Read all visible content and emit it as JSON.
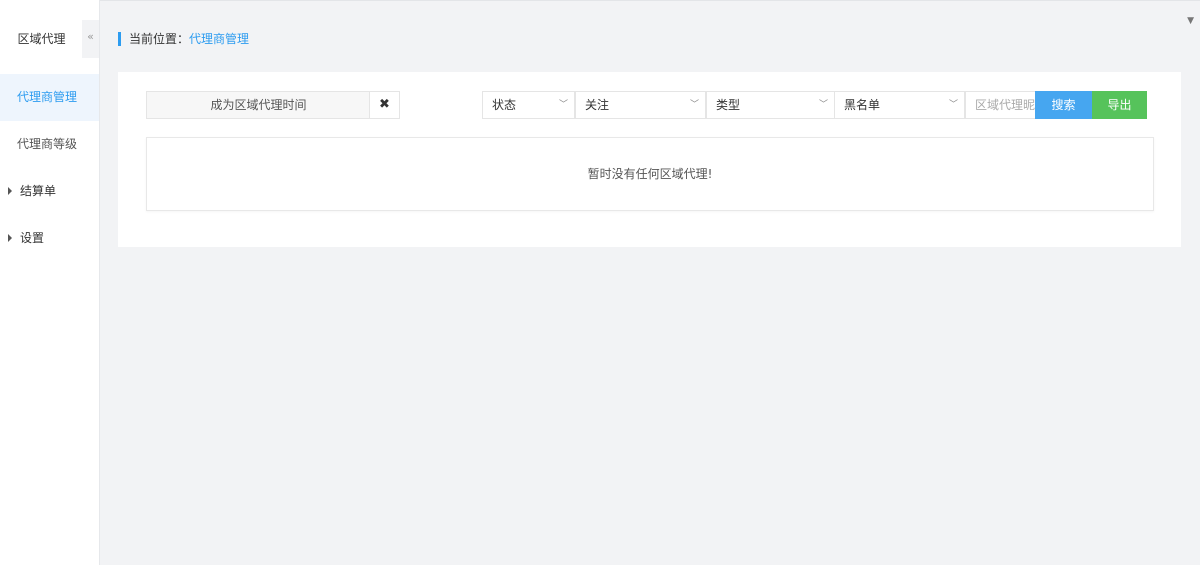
{
  "sidebar": {
    "title": "区域代理",
    "collapse_icon": "«",
    "items": [
      {
        "label": "代理商管理",
        "active": true
      },
      {
        "label": "代理商等级",
        "active": false
      }
    ],
    "groups": [
      {
        "label": "结算单"
      },
      {
        "label": "设置"
      }
    ]
  },
  "breadcrumb": {
    "prefix": "当前位置：",
    "current": "代理商管理"
  },
  "filters": {
    "date_placeholder": "成为区域代理时间",
    "clear_icon": "✖",
    "status_label": "状态",
    "follow_label": "关注",
    "type_label": "类型",
    "blacklist_label": "黑名单",
    "chevron_icon": "﹀",
    "keyword_placeholder": "区域代理昵称",
    "search_label": "搜索",
    "export_label": "导出"
  },
  "empty_message": "暂时没有任何区域代理!",
  "colors": {
    "accent": "#2d9cf0",
    "search_button": "#46a6f0",
    "export_button": "#56c35b",
    "background": "#f2f3f5"
  }
}
